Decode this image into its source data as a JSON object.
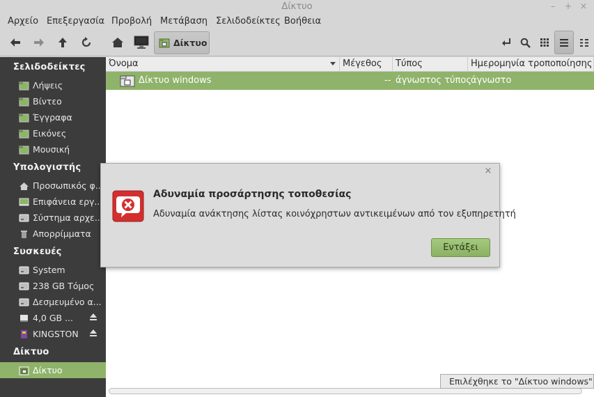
{
  "window": {
    "title": "Δίκτυο",
    "minimize_glyph": "–",
    "maximize_glyph": "+",
    "close_glyph": "×"
  },
  "menu": [
    "Αρχείο",
    "Επεξεργασία",
    "Προβολή",
    "Μετάβαση",
    "Σελιδοδείκτες",
    "Βοήθεια"
  ],
  "toolbar": {
    "icons": [
      "back-arrow-icon",
      "forward-arrow-icon",
      "up-arrow-icon",
      "reload-icon",
      "home-icon",
      "computer-icon"
    ],
    "location_label": "Δίκτυο",
    "right_icons": [
      "path-toggle-icon",
      "search-icon",
      "icon-view-icon",
      "list-view-icon",
      "compact-view-icon"
    ]
  },
  "sidebar": {
    "bookmarks_header": "Σελιδοδείκτες",
    "bookmarks": [
      "Λήψεις",
      "Βίντεο",
      "Έγγραφα",
      "Εικόνες",
      "Μουσική"
    ],
    "computer_header": "Υπολογιστής",
    "computer": [
      "Προσωπικός φ...",
      "Επιφάνεια εργ...",
      "Σύστημα αρχε...",
      "Απορρίμματα"
    ],
    "devices_header": "Συσκευές",
    "devices": [
      "System",
      "238 GB Τόμος",
      "Δεσμευμένο α...",
      "4,0 GB ...",
      "KINGSTON"
    ],
    "network_header": "Δίκτυο",
    "network": [
      "Δίκτυο"
    ]
  },
  "columns": {
    "name": "Όνομα",
    "size": "Μέγεθος",
    "type": "Τύπος",
    "modified": "Ημερομηνία τροποποίησης"
  },
  "rows": [
    {
      "name": "Δίκτυο windows",
      "size": "--",
      "type": "άγνωστος τύπος",
      "modified": "άγνωστο"
    }
  ],
  "status": "Επιλέχθηκε το \"Δίκτυο windows\"",
  "dialog": {
    "title": "Αδυναμία προσάρτησης τοποθεσίας",
    "message": "Αδυναμία ανάκτησης λίστας κοινόχρηστων αντικειμένων από τον εξυπηρετητή",
    "ok_label": "Εντάξει",
    "close_glyph": "×"
  },
  "colors": {
    "accent_green": "#8fb36a",
    "sidebar_bg": "#3c3c3c",
    "error_red": "#d32f2f"
  }
}
